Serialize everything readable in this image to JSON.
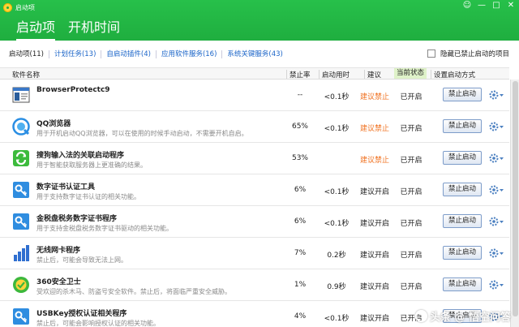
{
  "window": {
    "title": "启动项",
    "controls": [
      "☺",
      "—",
      "□",
      "✕"
    ]
  },
  "tabs": [
    {
      "label": "启动项",
      "active": true
    },
    {
      "label": "开机时间",
      "active": false
    }
  ],
  "filters": [
    {
      "label": "启动项(11)"
    },
    {
      "label": "计划任务(13)"
    },
    {
      "label": "自启动插件(4)"
    },
    {
      "label": "应用软件服务(16)"
    },
    {
      "label": "系统关键服务(43)"
    }
  ],
  "hide_disabled_label": "隐藏已禁止启动的项目",
  "columns": {
    "name": "软件名称",
    "rate": "禁止率",
    "time": "启动用时",
    "suggest": "建议",
    "status": "当前状态",
    "method": "设置启动方式"
  },
  "rows": [
    {
      "name": "BrowserProtectc9",
      "desc": "",
      "rate": "--",
      "time": "<0.1秒",
      "suggest": "建议禁止",
      "suggest_warn": true,
      "status": "已开启",
      "button": "禁止启动",
      "icon": "app-window-icon"
    },
    {
      "name": "QQ浏览器",
      "desc": "用于开机启动QQ浏览器，可以在使用的时候手动启动，不需要开机自启。",
      "rate": "65%",
      "time": "<0.1秒",
      "suggest": "建议禁止",
      "suggest_warn": true,
      "status": "已开启",
      "button": "禁止启动",
      "icon": "qq-browser-icon"
    },
    {
      "name": "搜狗输入法的关联启动程序",
      "desc": "用于智能获取服务器上更准确的结果。",
      "rate": "53%",
      "time": "",
      "suggest": "建议禁止",
      "suggest_warn": true,
      "status": "已开启",
      "button": "禁止启动",
      "icon": "sogou-icon"
    },
    {
      "name": "数字证书认证工具",
      "desc": "用于支持数字证书认证的相关功能。",
      "rate": "6%",
      "time": "<0.1秒",
      "suggest": "建议开启",
      "suggest_warn": false,
      "status": "已开启",
      "button": "禁止启动",
      "icon": "certificate-icon"
    },
    {
      "name": "金税盘税务数字证书程序",
      "desc": "用于支持金税盘税务数字证书驱动的相关功能。",
      "rate": "6%",
      "time": "<0.1秒",
      "suggest": "建议开启",
      "suggest_warn": false,
      "status": "已开启",
      "button": "禁止启动",
      "icon": "certificate-icon"
    },
    {
      "name": "无线网卡程序",
      "desc": "禁止后，可能会导致无法上网。",
      "rate": "7%",
      "time": "0.2秒",
      "suggest": "建议开启",
      "suggest_warn": false,
      "status": "已开启",
      "button": "禁止启动",
      "icon": "wireless-bars-icon"
    },
    {
      "name": "360安全卫士",
      "desc": "受欢迎的杀木马、防盗号安全软件。禁止后，将面临严重安全威胁。",
      "rate": "1%",
      "time": "0.9秒",
      "suggest": "建议开启",
      "suggest_warn": false,
      "status": "已开启",
      "button": "禁止启动",
      "icon": "360-shield-icon"
    },
    {
      "name": "USBKey授权认证相关程序",
      "desc": "禁止后，可能会影响授权认证的相关功能。",
      "rate": "4%",
      "time": "<0.1秒",
      "suggest": "建议开启",
      "suggest_warn": false,
      "status": "已开启",
      "button": "禁止启动",
      "icon": "certificate-icon"
    }
  ],
  "watermark": "头条 @ 悟空问答",
  "colors": {
    "header_green": "#1fae3f",
    "link_blue": "#1a64c8",
    "warn_orange": "#f07323",
    "current_status_bg": "#dff2c9"
  }
}
